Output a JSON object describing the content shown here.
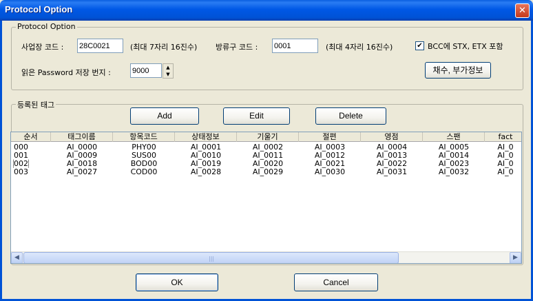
{
  "window": {
    "title": "Protocol Option",
    "close_glyph": "✕"
  },
  "protocol_group": {
    "legend": "Protocol Option",
    "site_code_label": "사업장 코드 :",
    "site_code_value": "28C0021",
    "site_code_hint": "(최대 7자리 16진수)",
    "outlet_code_label": "방류구 코드 :",
    "outlet_code_value": "0001",
    "outlet_code_hint": "(최대 4자리 16진수)",
    "bcc_checked": true,
    "bcc_label": "BCC에 STX, ETX 포함",
    "password_label": "읽은 Password 저장 번지 :",
    "password_value": "9000",
    "extra_button": "채수, 부가정보"
  },
  "tags_group": {
    "legend": "등록된 태그",
    "add_label": "Add",
    "edit_label": "Edit",
    "delete_label": "Delete"
  },
  "table": {
    "columns": [
      "순서",
      "태그이름",
      "항목코드",
      "상태정보",
      "기울기",
      "절편",
      "영점",
      "스팬",
      "fact"
    ],
    "rows": [
      [
        "000",
        "AI_0000",
        "PHY00",
        "AI_0001",
        "AI_0002",
        "AI_0003",
        "AI_0004",
        "AI_0005",
        "AI_0"
      ],
      [
        "001",
        "AI_0009",
        "SUS00",
        "AI_0010",
        "AI_0011",
        "AI_0012",
        "AI_0013",
        "AI_0014",
        "AI_0"
      ],
      [
        "002",
        "AI_0018",
        "BOD00",
        "AI_0019",
        "AI_0020",
        "AI_0021",
        "AI_0022",
        "AI_0023",
        "AI_0"
      ],
      [
        "003",
        "AI_0027",
        "COD00",
        "AI_0028",
        "AI_0029",
        "AI_0030",
        "AI_0031",
        "AI_0032",
        "AI_0"
      ]
    ],
    "focused_row": 2
  },
  "scrollbar": {
    "left_arrow": "◀",
    "right_arrow": "▶",
    "grip": "|||"
  },
  "footer": {
    "ok_label": "OK",
    "cancel_label": "Cancel"
  }
}
